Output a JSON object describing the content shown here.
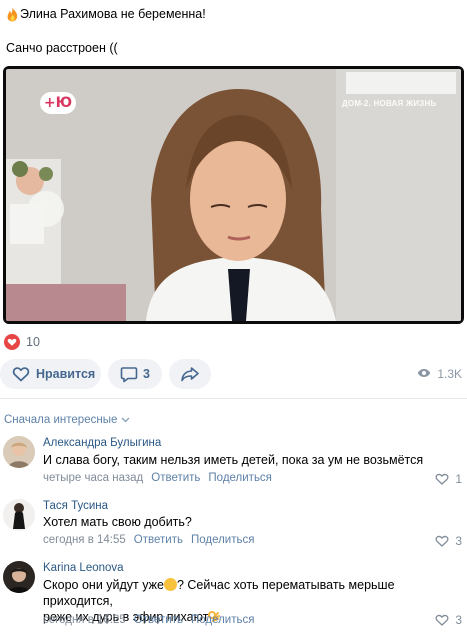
{
  "post": {
    "title": "Элина Рахимова не беременна!",
    "subtitle": "Санчо расстроен ((",
    "title_icon": "fire-emoji"
  },
  "video": {
    "channel_logo": "+Ю",
    "show_label": "ДОМ-2. НОВАЯ ЖИЗНЬ"
  },
  "reactions": {
    "icon": "heart-reaction",
    "count": "10"
  },
  "actions": {
    "like_label": "Нравится",
    "comments_count": "3",
    "views": "1.3K"
  },
  "comments_sort": "Сначала интересные",
  "comments": [
    {
      "author": "Александра Булыгина",
      "text": "И слава богу, таким нельзя иметь детей, пока за ум не возьмётся",
      "time": "четыре часа назад",
      "reply": "Ответить",
      "share": "Поделиться",
      "likes": "1"
    },
    {
      "author": "Тася Тусина",
      "text": "Хотел мать свою добить?",
      "time": "сегодня в 14:55",
      "reply": "Ответить",
      "share": "Поделиться",
      "likes": "3"
    },
    {
      "author": "Karina Leonova",
      "text_part1": "Скоро они уйдут уже",
      "text_part2": "? Сейчас хоть перематывать мерьше приходится,",
      "text_line2": "реже их дурь в эфир пихают",
      "time": "сегодня в 16:25",
      "reply": "Ответить",
      "share": "Поделиться",
      "likes": "3"
    }
  ],
  "colors": {
    "link": "#2a5885",
    "secondary": "#818c99",
    "action_blue": "#45678f",
    "pill_bg": "#f0f2f5",
    "reaction_red": "#e64646"
  }
}
